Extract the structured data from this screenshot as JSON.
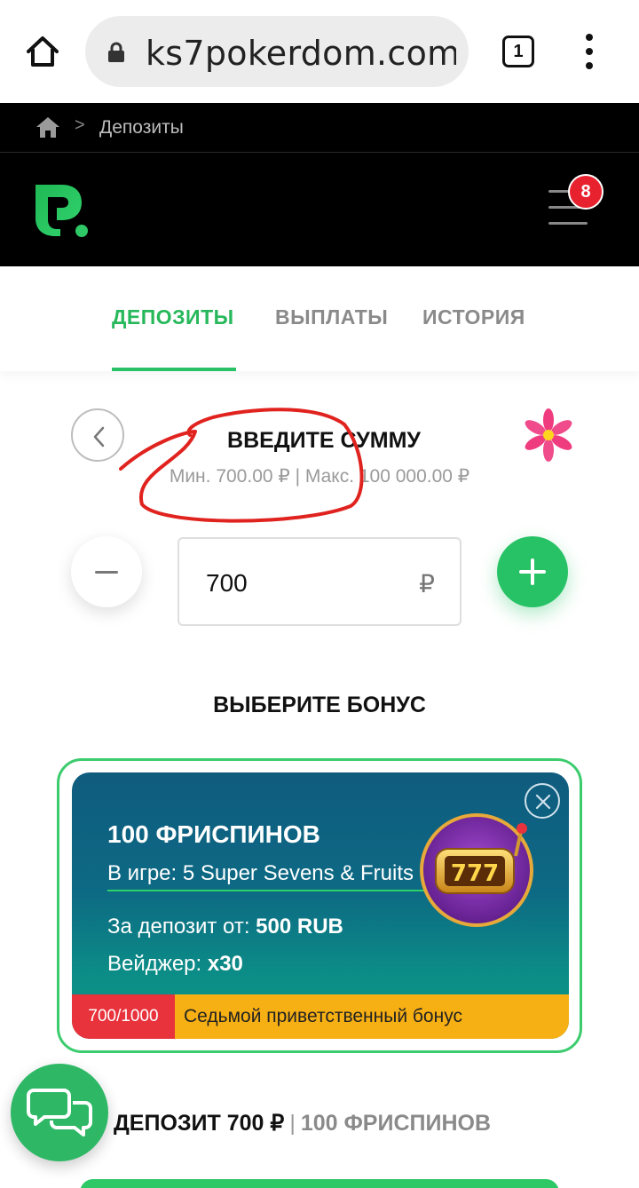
{
  "browser": {
    "url": "ks7pokerdom.com",
    "tab_count": "1"
  },
  "breadcrumb": {
    "separator": ">",
    "current": "Депозиты"
  },
  "header": {
    "notification_count": "8"
  },
  "tabs": [
    {
      "label": "ДЕПОЗИТЫ",
      "active": true
    },
    {
      "label": "ВЫПЛАТЫ",
      "active": false
    },
    {
      "label": "ИСТОРИЯ",
      "active": false
    }
  ],
  "amount": {
    "title": "ВВЕДИТЕ СУММУ",
    "limits": "Мин. 700.00 ₽ | Макс. 100 000.00 ₽",
    "value": "700",
    "currency": "₽"
  },
  "bonus": {
    "heading": "ВЫБЕРИТЕ БОНУС",
    "title": "100 ФРИСПИНОВ",
    "game": "В игре: 5 Super Sevens & Fruits",
    "deposit_label": "За депозит от:",
    "deposit_value": "500 RUB",
    "wager_label": "Вейджер:",
    "wager_value": "x30",
    "slot_text": "777",
    "progress": "700/1000",
    "bonus_name": "Седьмой приветственный бонус"
  },
  "summary": {
    "deposit": "ДЕПОЗИТ 700 ₽",
    "separator": "|",
    "bonus": "100 ФРИСПИНОВ"
  },
  "colors": {
    "accent": "#27c266",
    "badge": "#e8212f",
    "annotation": "#e0231f"
  }
}
